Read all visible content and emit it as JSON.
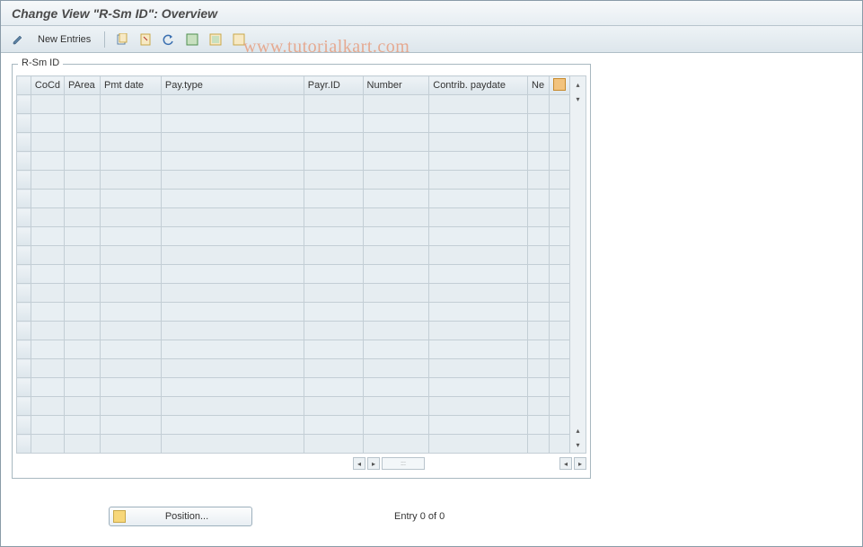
{
  "header": {
    "title": "Change View \"R-Sm ID\": Overview"
  },
  "toolbar": {
    "new_entries_label": "New Entries",
    "icons": {
      "change": "change-icon",
      "copy": "copy-icon",
      "delete": "delete-icon",
      "undo": "undo-icon",
      "select_all": "select-all-icon",
      "select_block": "select-block-icon",
      "deselect": "deselect-icon"
    }
  },
  "watermark": "www.tutorialkart.com",
  "group": {
    "legend": "R-Sm ID"
  },
  "grid": {
    "columns": [
      "CoCd",
      "PArea",
      "Pmt date",
      "Pay.type",
      "Payr.ID",
      "Number",
      "Contrib. paydate",
      "Ne"
    ],
    "row_count": 19
  },
  "footer": {
    "position_label": "Position...",
    "status_text": "Entry 0 of 0"
  }
}
